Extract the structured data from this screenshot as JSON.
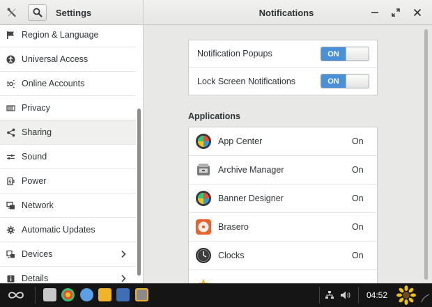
{
  "header": {
    "left_title": "Settings",
    "title": "Notifications"
  },
  "sidebar": {
    "items": [
      {
        "label": "Region & Language",
        "icon": "flag-icon"
      },
      {
        "label": "Universal Access",
        "icon": "accessibility-icon"
      },
      {
        "label": "Online Accounts",
        "icon": "accounts-icon"
      },
      {
        "label": "Privacy",
        "icon": "privacy-icon"
      },
      {
        "label": "Sharing",
        "icon": "share-icon",
        "active": true
      },
      {
        "label": "Sound",
        "icon": "sound-icon"
      },
      {
        "label": "Power",
        "icon": "power-icon"
      },
      {
        "label": "Network",
        "icon": "network-icon"
      },
      {
        "label": "Automatic Updates",
        "icon": "gear-icon"
      },
      {
        "label": "Devices",
        "icon": "devices-icon",
        "chevron": true
      },
      {
        "label": "Details",
        "icon": "info-icon",
        "chevron": true
      }
    ]
  },
  "notifications": {
    "popups_label": "Notification Popups",
    "popups_state": "ON",
    "lockscreen_label": "Lock Screen Notifications",
    "lockscreen_state": "ON"
  },
  "applications": {
    "title": "Applications",
    "items": [
      {
        "name": "App Center",
        "state": "On",
        "icon": "app-center-icon"
      },
      {
        "name": "Archive Manager",
        "state": "On",
        "icon": "archive-manager-icon"
      },
      {
        "name": "Banner Designer",
        "state": "On",
        "icon": "banner-designer-icon"
      },
      {
        "name": "Brasero",
        "state": "On",
        "icon": "brasero-icon"
      },
      {
        "name": "Clocks",
        "state": "On",
        "icon": "clocks-icon"
      }
    ]
  },
  "taskbar": {
    "clock": "04:52"
  },
  "colors": {
    "accent": "#4a90d9",
    "taskbar": "#151515"
  }
}
